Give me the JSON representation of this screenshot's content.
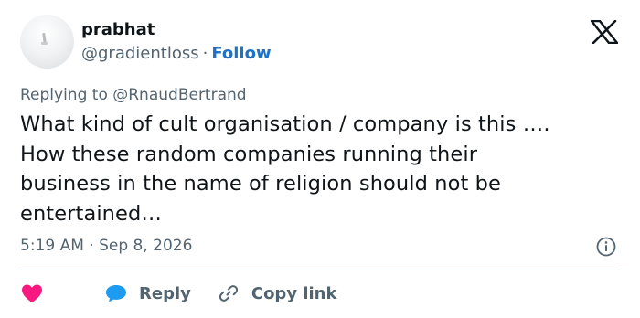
{
  "user": {
    "name": "prabhat",
    "handle": "@gradientloss",
    "separator": "·",
    "follow_label": "Follow"
  },
  "reply_context": {
    "prefix": "Replying to",
    "target": "@RnaudBertrand"
  },
  "tweet": {
    "text": "What kind of cult organisation / company is this ….\nHow these random companies running their\nbusiness in the name of religion should not be\nentertained…",
    "timestamp": "5:19 AM · Sep 8, 2026"
  },
  "actions": {
    "reply_label": "Reply",
    "copy_link_label": "Copy link"
  },
  "icons": {
    "brand": "x-logo-icon",
    "like": "heart-icon",
    "reply": "speech-bubble-icon",
    "copy": "link-icon",
    "info": "info-icon"
  },
  "colors": {
    "text": "#0f1419",
    "secondary": "#536471",
    "follow": "#1d73c9",
    "like": "#f91880",
    "reply": "#1d9bf0",
    "divider": "#cfd9de"
  }
}
